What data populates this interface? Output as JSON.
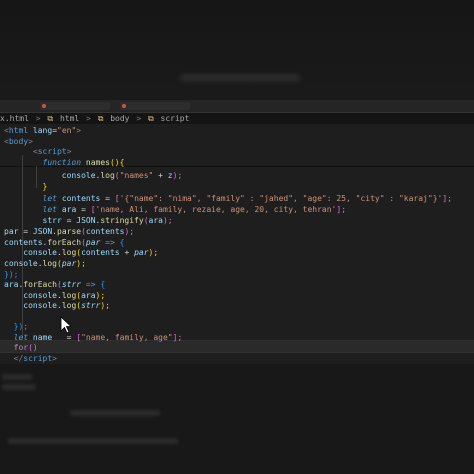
{
  "breadcrumb": {
    "items": [
      "x.html",
      ">",
      "html",
      ">",
      "body",
      ">",
      "script"
    ]
  },
  "code": [
    {
      "tokens": [
        [
          "<",
          "t"
        ],
        [
          "html",
          "tg"
        ],
        [
          " lang",
          "at"
        ],
        [
          "=",
          "p"
        ],
        [
          "\"en\"",
          "s"
        ],
        [
          ">",
          "t"
        ]
      ]
    },
    {
      "tokens": [
        [
          "<",
          "t"
        ],
        [
          "body",
          "tg"
        ],
        [
          ">",
          "t"
        ]
      ]
    },
    {
      "tokens": [
        [
          "      <",
          "t"
        ],
        [
          "script",
          "tg"
        ],
        [
          ">",
          "t"
        ]
      ]
    },
    {
      "tokens": [
        [
          "        ",
          "p"
        ],
        [
          "function",
          "k"
        ],
        [
          " ",
          "p"
        ],
        [
          "names",
          "fn"
        ],
        [
          "(){",
          "br"
        ]
      ]
    },
    {
      "tokens": [
        [
          "            ",
          "p"
        ],
        [
          "console",
          "v"
        ],
        [
          ".",
          "p"
        ],
        [
          "log",
          "fn"
        ],
        [
          "(",
          "brp"
        ],
        [
          "\"names\"",
          "s"
        ],
        [
          " + ",
          "p"
        ],
        [
          "z",
          "v"
        ],
        [
          ");",
          "brp"
        ]
      ]
    },
    {
      "tokens": [
        [
          "        }",
          "br"
        ]
      ]
    },
    {
      "tokens": [
        [
          "        ",
          "p"
        ],
        [
          "let",
          "k"
        ],
        [
          " ",
          "p"
        ],
        [
          "contents",
          "v"
        ],
        [
          " = ",
          "p"
        ],
        [
          "[",
          "brp"
        ],
        [
          "'{\"name\": \"nima\", \"family\" : \"jahed\", \"age\": 25, \"city\" : \"karaj\"}'",
          "s"
        ],
        [
          "];",
          "brp"
        ]
      ]
    },
    {
      "tokens": [
        [
          "        ",
          "p"
        ],
        [
          "let",
          "k"
        ],
        [
          " ",
          "p"
        ],
        [
          "ara",
          "v"
        ],
        [
          " = ",
          "p"
        ],
        [
          "[",
          "brp"
        ],
        [
          "'name, Ali, family, rezaie, age, 20, city, tehran'",
          "s"
        ],
        [
          "];",
          "brp"
        ]
      ]
    },
    {
      "tokens": [
        [
          "        ",
          "p"
        ],
        [
          "strr",
          "v"
        ],
        [
          " = ",
          "p"
        ],
        [
          "JSON",
          "v"
        ],
        [
          ".",
          "p"
        ],
        [
          "stringify",
          "fn"
        ],
        [
          "(",
          "brp"
        ],
        [
          "ara",
          "v"
        ],
        [
          ");",
          "brp"
        ]
      ]
    },
    {
      "tokens": [
        [
          "par",
          "v"
        ],
        [
          " = ",
          "p"
        ],
        [
          "JSON",
          "v"
        ],
        [
          ".",
          "p"
        ],
        [
          "parse",
          "fn"
        ],
        [
          "(",
          "brp"
        ],
        [
          "contents",
          "v"
        ],
        [
          ");",
          "brp"
        ]
      ]
    },
    {
      "tokens": [
        [
          "contents",
          "v"
        ],
        [
          ".",
          "p"
        ],
        [
          "forEach",
          "fn"
        ],
        [
          "(",
          "brp"
        ],
        [
          "par",
          "vi"
        ],
        [
          " => ",
          "k"
        ],
        [
          "{",
          "brb"
        ]
      ]
    },
    {
      "tokens": [
        [
          "    ",
          "p"
        ],
        [
          "console",
          "v"
        ],
        [
          ".",
          "p"
        ],
        [
          "log",
          "fn"
        ],
        [
          "(",
          "br"
        ],
        [
          "contents",
          "v"
        ],
        [
          " + ",
          "p"
        ],
        [
          "par",
          "vi"
        ],
        [
          ");",
          "br"
        ]
      ]
    },
    {
      "tokens": [
        [
          "console",
          "v"
        ],
        [
          ".",
          "p"
        ],
        [
          "log",
          "fn"
        ],
        [
          "(",
          "br"
        ],
        [
          "par",
          "vi"
        ],
        [
          ");",
          "br"
        ]
      ]
    },
    {
      "tokens": [
        [
          "});",
          "brb"
        ]
      ]
    },
    {
      "tokens": [
        [
          "ara",
          "v"
        ],
        [
          ".",
          "p"
        ],
        [
          "forEach",
          "fn"
        ],
        [
          "(",
          "brp"
        ],
        [
          "strr",
          "vi"
        ],
        [
          " => ",
          "k"
        ],
        [
          "{",
          "brb"
        ]
      ]
    },
    {
      "tokens": [
        [
          "    ",
          "p"
        ],
        [
          "console",
          "v"
        ],
        [
          ".",
          "p"
        ],
        [
          "log",
          "fn"
        ],
        [
          "(",
          "br"
        ],
        [
          "ara",
          "v"
        ],
        [
          ");",
          "br"
        ]
      ]
    },
    {
      "tokens": [
        [
          "    ",
          "p"
        ],
        [
          "console",
          "v"
        ],
        [
          ".",
          "p"
        ],
        [
          "log",
          "fn"
        ],
        [
          "(",
          "br"
        ],
        [
          "strr",
          "vi"
        ],
        [
          ");",
          "br"
        ]
      ]
    },
    {
      "tokens": [
        [
          "",
          "p"
        ]
      ]
    },
    {
      "tokens": [
        [
          "  });",
          "brb"
        ]
      ]
    },
    {
      "tokens": [
        [
          "  ",
          "p"
        ],
        [
          "let",
          "k"
        ],
        [
          " ",
          "p"
        ],
        [
          "name",
          "v"
        ],
        [
          "   = ",
          "p"
        ],
        [
          "[",
          "brp"
        ],
        [
          "\"name, family, age\"",
          "s"
        ],
        [
          "];",
          "brp"
        ]
      ]
    },
    {
      "tokens": [
        [
          "  ",
          "p"
        ],
        [
          "for",
          "ctl"
        ],
        [
          "()",
          "brp"
        ]
      ]
    },
    {
      "tokens": [
        [
          "  </",
          "t"
        ],
        [
          "script",
          "tg"
        ],
        [
          ">",
          "t"
        ]
      ]
    }
  ]
}
